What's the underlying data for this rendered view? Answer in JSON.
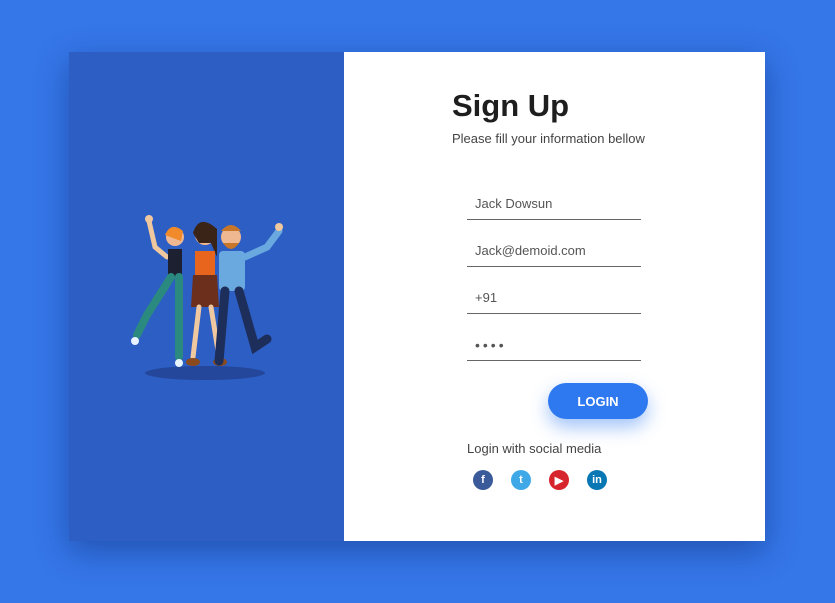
{
  "form": {
    "title": "Sign Up",
    "subtitle": "Please fill your information bellow",
    "fields": [
      {
        "name": "name",
        "value": "Jack Dowsun"
      },
      {
        "name": "email",
        "value": "Jack@demoid.com"
      },
      {
        "name": "phone",
        "value": "+91"
      },
      {
        "name": "password",
        "value": "••••"
      }
    ],
    "login_label": "LOGIN",
    "social_label": "Login with social media"
  },
  "social": [
    {
      "icon": "facebook-icon",
      "glyph": "f"
    },
    {
      "icon": "twitter-icon",
      "glyph": "t"
    },
    {
      "icon": "youtube-icon",
      "glyph": "▶"
    },
    {
      "icon": "linkedin-icon",
      "glyph": "in"
    }
  ],
  "colors": {
    "background": "#3576e8",
    "panel": "#2c5ec4",
    "accent": "#2f79f0"
  }
}
